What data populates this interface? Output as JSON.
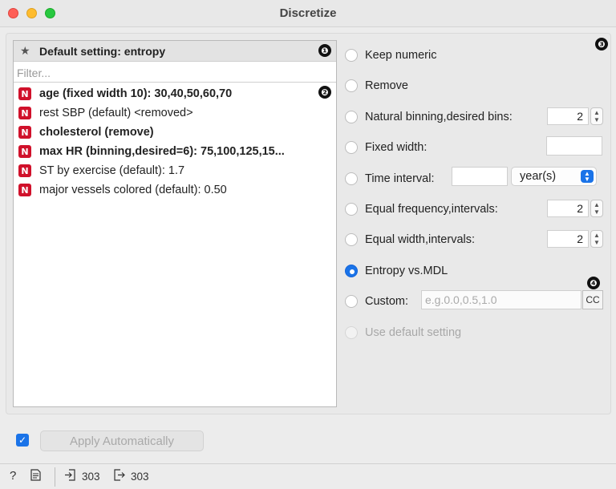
{
  "window": {
    "title": "Discretize"
  },
  "left": {
    "default_label": "Default setting: entropy",
    "filter_placeholder": "Filter...",
    "badges": [
      "❶",
      "❷"
    ],
    "variables": [
      {
        "label": "age (fixed width 10): 30,40,50,60,70",
        "bold": true
      },
      {
        "label": "rest SBP (default) <removed>",
        "bold": false
      },
      {
        "label": "cholesterol (remove)",
        "bold": true
      },
      {
        "label": "max HR (binning,desired=6): 75,100,125,15...",
        "bold": true
      },
      {
        "label": "ST by exercise (default): 1.7",
        "bold": false
      },
      {
        "label": "major vessels colored (default): 0.50",
        "bold": false
      }
    ]
  },
  "right": {
    "badges": [
      "❸",
      "❹"
    ],
    "options": {
      "keep_numeric": "Keep numeric",
      "remove": "Remove",
      "natural": "Natural binning,desired bins:",
      "fixed_width": "Fixed width:",
      "time_interval": "Time interval:",
      "equal_freq": "Equal frequency,intervals:",
      "equal_width": "Equal width,intervals:",
      "entropy": "Entropy vs.MDL",
      "custom": "Custom:",
      "use_default": "Use default setting"
    },
    "natural_bins": "2",
    "equal_freq_value": "2",
    "equal_width_value": "2",
    "time_unit": "year(s)",
    "custom_placeholder": "e.g.0.0,0.5,1.0",
    "cc_label": "CC",
    "selected": "entropy"
  },
  "bottom": {
    "apply_label": "Apply Automatically",
    "apply_checked": true
  },
  "status": {
    "input_count": "303",
    "output_count": "303"
  },
  "colors": {
    "accent": "#1a73e8",
    "n_icon": "#d0112b"
  }
}
